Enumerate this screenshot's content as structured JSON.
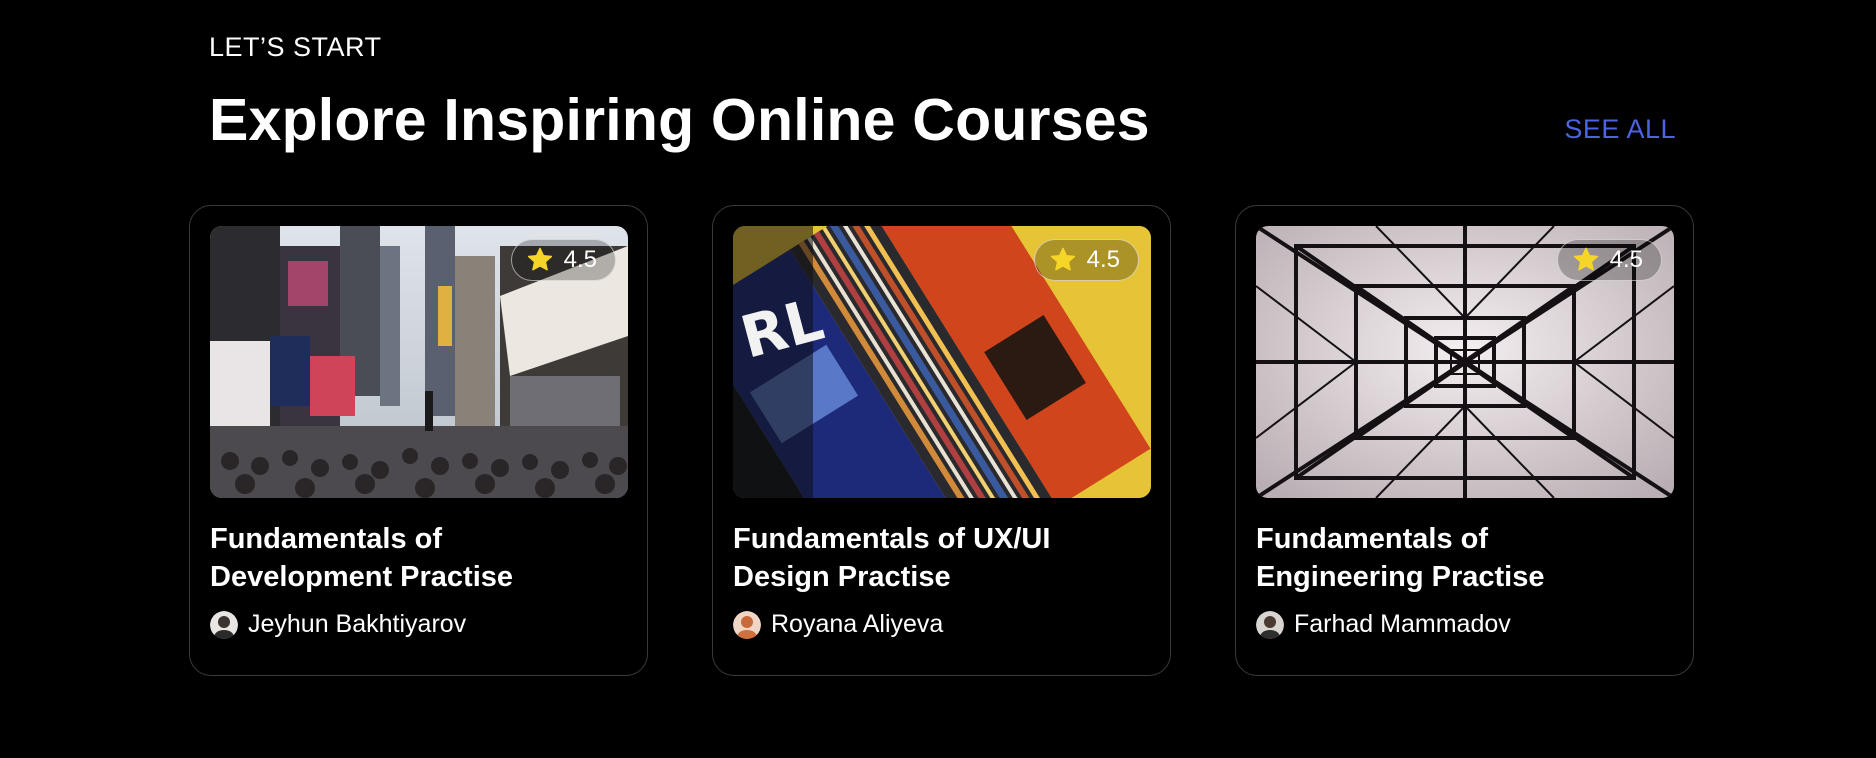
{
  "section": {
    "eyebrow": "LET’S START",
    "title": "Explore Inspiring Online Courses",
    "see_all": "SEE ALL"
  },
  "colors": {
    "background": "#000000",
    "accent": "#4d63e0",
    "star": "#f5d628",
    "card_border": "#3a3a3a"
  },
  "courses": [
    {
      "title": "Fundamentals of Development Practise",
      "author": "Jeyhun Bakhtiyarov",
      "rating": "4.5",
      "image": "city-street-billboards"
    },
    {
      "title": "Fundamentals of UX/UI Design Practise",
      "author": "Royana Aliyeva",
      "rating": "4.5",
      "image": "colorful-posters-collage"
    },
    {
      "title": "Fundamentals of Engineering Practise",
      "author": "Farhad Mammadov",
      "rating": "4.5",
      "image": "power-tower-steel-lattice"
    }
  ]
}
